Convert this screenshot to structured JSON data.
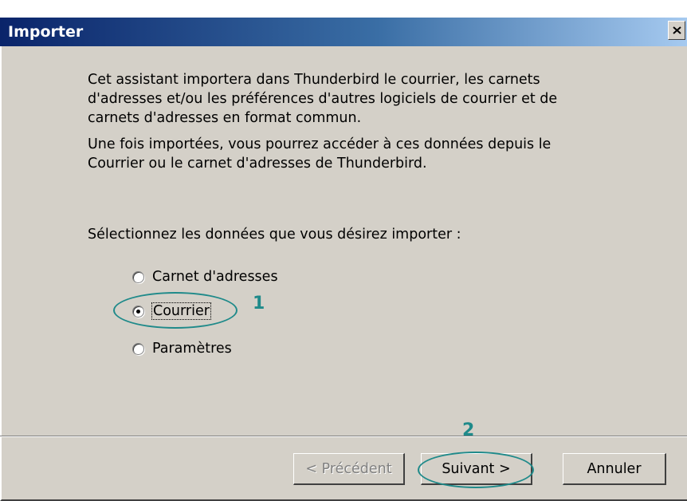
{
  "window": {
    "title": "Importer",
    "close_label": "X"
  },
  "intro": {
    "paragraph1": "Cet assistant importera dans Thunderbird le courrier, les carnets d'adresses et/ou les préférences d'autres logiciels de courrier et de carnets d'adresses en format commun.",
    "paragraph2": "Une fois importées, vous pourrez accéder à ces données depuis le Courrier ou le carnet d'adresses de Thunderbird."
  },
  "selection": {
    "label": "Sélectionnez les données que vous désirez importer :",
    "options": [
      {
        "label": "Carnet d'adresses",
        "checked": false
      },
      {
        "label": "Courrier",
        "checked": true
      },
      {
        "label": "Paramètres",
        "checked": false
      }
    ]
  },
  "annotations": {
    "step1": "1",
    "step2": "2",
    "color": "#1f8a8a"
  },
  "buttons": {
    "previous": "< Précédent",
    "next": "Suivant >",
    "cancel": "Annuler"
  }
}
